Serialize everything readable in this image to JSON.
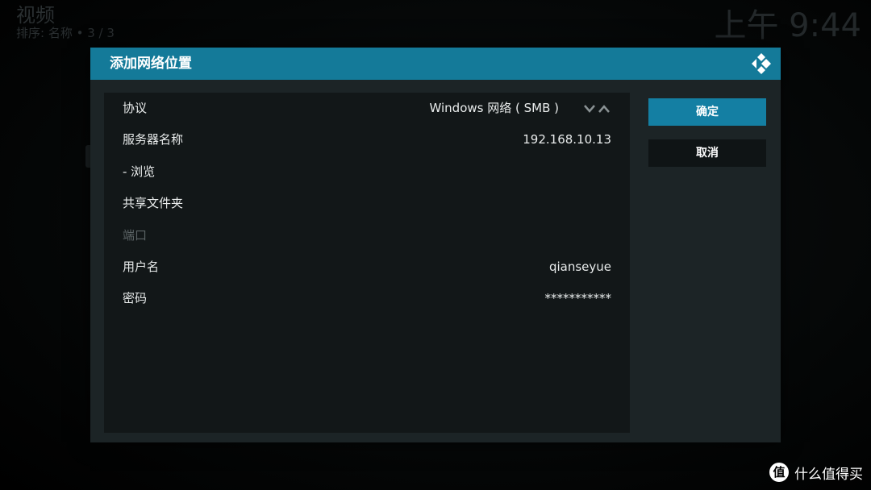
{
  "background": {
    "section_title": "视频",
    "sort_info": "排序: 名称  •  3 / 3",
    "clock": "上午 9:44"
  },
  "dialog": {
    "title": "添加网络位置",
    "logo_icon": "kodi-logo-icon",
    "header_color": "#147a99",
    "rows": [
      {
        "label": "协议",
        "value": "Windows 网络 ( SMB )",
        "has_spinner": true,
        "enabled": true
      },
      {
        "label": "服务器名称",
        "value": "192.168.10.13",
        "enabled": true
      },
      {
        "label": "- 浏览",
        "value": "",
        "enabled": true
      },
      {
        "label": "共享文件夹",
        "value": "",
        "enabled": true
      },
      {
        "label": "端口",
        "value": "",
        "enabled": false
      },
      {
        "label": "用户名",
        "value": "qianseyue",
        "enabled": true
      },
      {
        "label": "密码",
        "value": "***********",
        "enabled": true
      }
    ],
    "buttons": {
      "ok_label": "确定",
      "cancel_label": "取消"
    },
    "accent_color": "#147fa3"
  },
  "watermark": {
    "icon_text": "值",
    "text": "什么值得买"
  }
}
